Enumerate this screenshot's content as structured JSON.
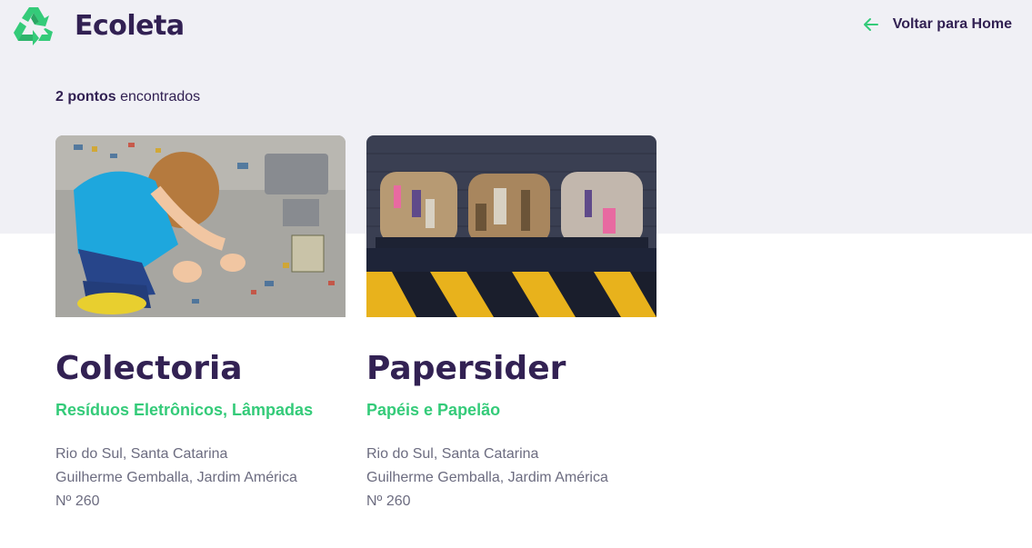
{
  "header": {
    "logo_text": "Ecoleta",
    "back_link_label": "Voltar para Home"
  },
  "results": {
    "count_label": "2 pontos",
    "suffix_label": " encontrados"
  },
  "points": [
    {
      "name": "Colectoria",
      "items": "Resíduos Eletrônicos, Lâmpadas",
      "city_state": "Rio do Sul, Santa Catarina",
      "street": "Guilherme Gemballa, Jardim América",
      "number": "Nº 260"
    },
    {
      "name": "Papersider",
      "items": "Papéis e Papelão",
      "city_state": "Rio do Sul, Santa Catarina",
      "street": "Guilherme Gemballa, Jardim América",
      "number": "Nº 260"
    }
  ],
  "colors": {
    "brand_dark": "#322153",
    "brand_green": "#34cb79",
    "text_muted": "#6c6c80",
    "background": "#f0f0f5"
  }
}
